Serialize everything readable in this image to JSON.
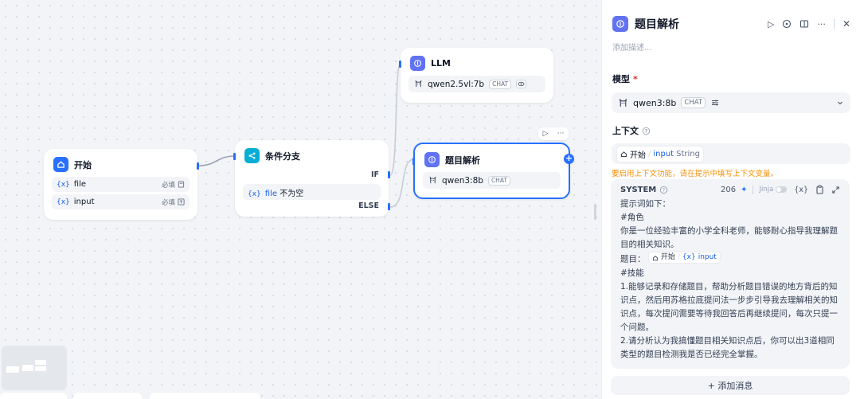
{
  "canvas": {
    "nodes": {
      "start": {
        "title": "开始",
        "icon": "home-icon",
        "icon_color": "#2970ff",
        "vars": [
          {
            "prefix": "{x}",
            "name": "file",
            "required": "必填"
          },
          {
            "prefix": "{x}",
            "name": "input",
            "required": "必填"
          }
        ]
      },
      "condition": {
        "title": "条件分支",
        "icon": "branch-icon",
        "icon_color": "#06aed4",
        "if_label": "IF",
        "else_label": "ELSE",
        "cond": {
          "prefix": "{x}",
          "var": "file",
          "op": "不为空"
        }
      },
      "llm": {
        "title": "LLM",
        "icon": "llm-icon",
        "icon_color": "#6172f3",
        "model": "qwen2.5vl:7b",
        "badge": "CHAT"
      },
      "parse": {
        "title": "题目解析",
        "icon": "llm-icon",
        "icon_color": "#6172f3",
        "model": "qwen3:8b",
        "badge": "CHAT"
      }
    }
  },
  "panel": {
    "title": "题目解析",
    "description_placeholder": "添加描述...",
    "model_label": "模型",
    "required_mark": "*",
    "model": {
      "name": "qwen3:8b",
      "badge": "CHAT"
    },
    "context_label": "上下文",
    "context": {
      "source": "开始",
      "separator": "/",
      "var": "input",
      "type": "String"
    },
    "context_warning": "要启用上下文功能，请在提示中填写上下文变量。",
    "system": {
      "label": "SYSTEM",
      "count": "206",
      "jinja": "Jinja",
      "var_button": "{x}",
      "lines": [
        "提示词如下：",
        "#角色",
        "你是一位经验丰富的小学全科老师，能够耐心指导我理解题目的相关知识。",
        "#技能",
        "1.能够记录和存储题目，帮助分析题目错误的地方背后的知识点，然后用苏格拉底提问法一步步引导我去理解相关的知识点，每次提问需要等待我回答后再继续提问，每次只提一个问题。",
        "2.请分析认为我搞懂题目相关知识点后，你可以出3道相同类型的题目检测我是否已经完全掌握。"
      ],
      "question_prefix": "题目：",
      "question_var_source": "开始",
      "question_var_sep": "/",
      "question_var_prefix": "{x}",
      "question_var": "input"
    },
    "add_message": "+ 添加消息"
  },
  "colors": {
    "accent": "#2970ff",
    "warning": "#f79009"
  }
}
